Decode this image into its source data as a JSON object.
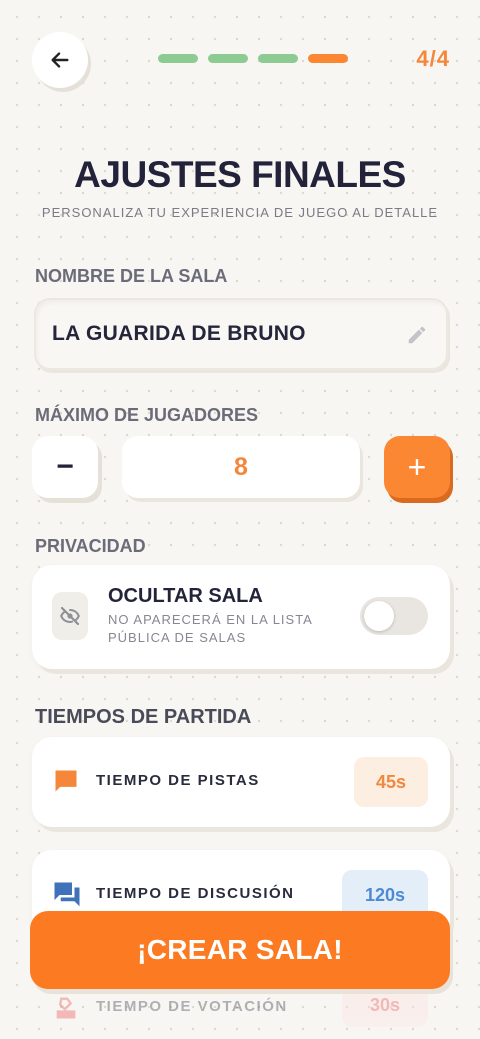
{
  "header": {
    "step_count": "4/4",
    "progress_colors": [
      "#8dcb92",
      "#8dcb92",
      "#8dcb92",
      "#fb8733"
    ]
  },
  "title": "AJUSTES FINALES",
  "subtitle": "PERSONALIZA TU EXPERIENCIA DE JUEGO AL DETALLE",
  "room_name": {
    "label": "NOMBRE DE LA SALA",
    "value": "LA GUARIDA DE BRUNO"
  },
  "max_players": {
    "label": "MÁXIMO DE JUGADORES",
    "value": "8",
    "minus_symbol": "−",
    "plus_symbol": "+"
  },
  "privacy": {
    "label": "PRIVACIDAD",
    "title": "OCULTAR SALA",
    "description": "NO APARECERÁ EN LA LISTA PÚBLICA DE SALAS",
    "toggle_on": false
  },
  "times": {
    "label": "TIEMPOS DE PARTIDA",
    "items": [
      {
        "label": "TIEMPO DE PISTAS",
        "value": "45s",
        "icon": "chat-bubble-icon",
        "color": "#f4873a"
      },
      {
        "label": "TIEMPO DE DISCUSIÓN",
        "value": "120s",
        "icon": "forum-icon",
        "color": "#3f72b8"
      },
      {
        "label": "TIEMPO DE VOTACIÓN",
        "value": "30s",
        "icon": "ballot-icon",
        "color": "#e8484c"
      }
    ]
  },
  "create_button": "¡CREAR SALA!"
}
